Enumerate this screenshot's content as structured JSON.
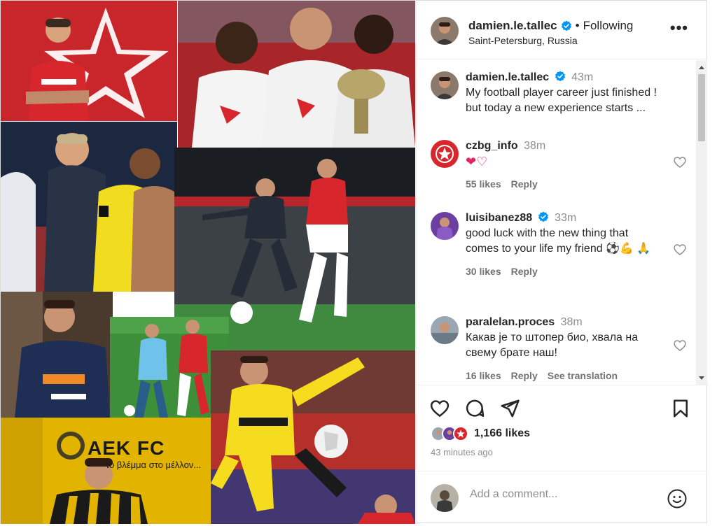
{
  "post": {
    "username": "damien.le.tallec",
    "separator": "•",
    "follow_status": "Following",
    "location": "Saint-Petersburg, Russia",
    "more_label": "•••"
  },
  "collage": {
    "tiles": [
      {
        "name": "red-star-photo",
        "bg": "#c9262c"
      },
      {
        "name": "trophy-celebration-photo",
        "bg": "#b32b2e"
      },
      {
        "name": "coach-hug-photo",
        "bg": "#1d2a44"
      },
      {
        "name": "arsenal-match-photo",
        "bg": "#2b3b2f"
      },
      {
        "name": "sponsor-portrait-photo",
        "bg": "#3a2f28"
      },
      {
        "name": "zenit-match-photo",
        "bg": "#3d8f3a"
      },
      {
        "name": "aek-fc-photo",
        "bg": "#e6b800"
      },
      {
        "name": "dortmund-match-photo",
        "bg": "#c0312b"
      }
    ],
    "aek_text": "AEK FC",
    "aek_subtext": "το βλέμμα στο μέλλον..."
  },
  "comments": [
    {
      "username": "damien.le.tallec",
      "verified": true,
      "time": "43m",
      "text": "My football player career just finished ! but today a new experience starts ...",
      "likes": "",
      "reply": "",
      "translation": ""
    },
    {
      "username": "czbg_info",
      "verified": false,
      "time": "38m",
      "text": "❤♡",
      "likes": "55 likes",
      "reply": "Reply",
      "translation": ""
    },
    {
      "username": "luisibanez88",
      "verified": true,
      "time": "33m",
      "text": "good luck with the new thing that comes to your life my friend ⚽💪 🙏",
      "likes": "30 likes",
      "reply": "Reply",
      "translation": ""
    },
    {
      "username": "paralelan.proces",
      "verified": false,
      "time": "38m",
      "text": "Какав је то штопер био, хвала на свему брате наш!",
      "likes": "16 likes",
      "reply": "Reply",
      "translation": "See translation"
    }
  ],
  "engagement": {
    "likes_count": "1,166 likes",
    "time_ago": "43 minutes ago"
  },
  "add_comment": {
    "placeholder": "Add a comment..."
  },
  "icons": {
    "verified": "verified-badge-icon",
    "like": "heart-icon",
    "comment": "comment-icon",
    "share": "paper-plane-icon",
    "save": "bookmark-icon",
    "emoji": "smiley-icon",
    "more": "more-options-icon"
  },
  "colors": {
    "verified": "#0095f6",
    "text": "#262626",
    "muted": "#8e8e8e",
    "heart": "#e0245e"
  }
}
